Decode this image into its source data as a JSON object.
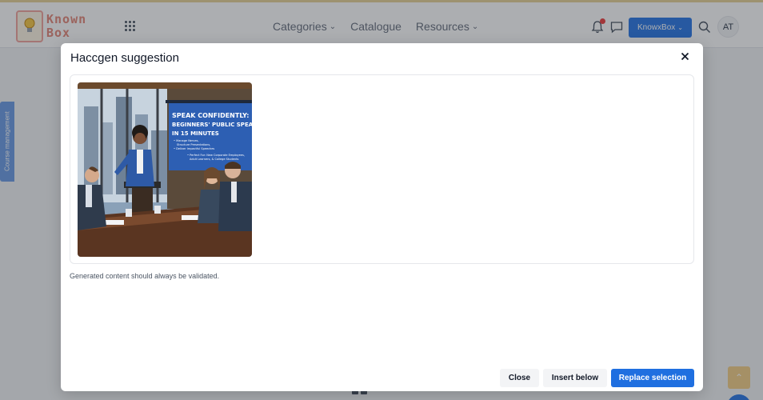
{
  "app": {
    "logo_text_line1": "Known",
    "logo_text_line2": "Box",
    "nav": [
      {
        "label": "Categories",
        "has_dropdown": true
      },
      {
        "label": "Catalogue",
        "has_dropdown": false
      },
      {
        "label": "Resources",
        "has_dropdown": true
      }
    ],
    "account_button_label": "KnowxBox",
    "avatar_initials": "AT",
    "side_tab_label": "Course management",
    "accent_color": "#2f7be6"
  },
  "modal": {
    "title": "Haccgen suggestion",
    "image_text": {
      "headline_1": "SPEAK CONFIDENTLY:",
      "headline_2": "BEGINNERS' PUBLIC SPEAKING",
      "headline_3": "IN 15 MINUTES",
      "bullet_1a": "• Manage Nerves,",
      "bullet_1b": "Structure Presentations,",
      "bullet_1c": "• Deliver Impactful Speeches",
      "bullet_2a": "• Perfect For: New Corporate Employees,",
      "bullet_2b": "Adult Learners, & College Students"
    },
    "validation_note": "Generated content should always be validated.",
    "buttons": {
      "close": "Close",
      "insert_below": "Insert below",
      "replace_selection": "Replace selection"
    },
    "primary_color": "#1f6fe0"
  }
}
